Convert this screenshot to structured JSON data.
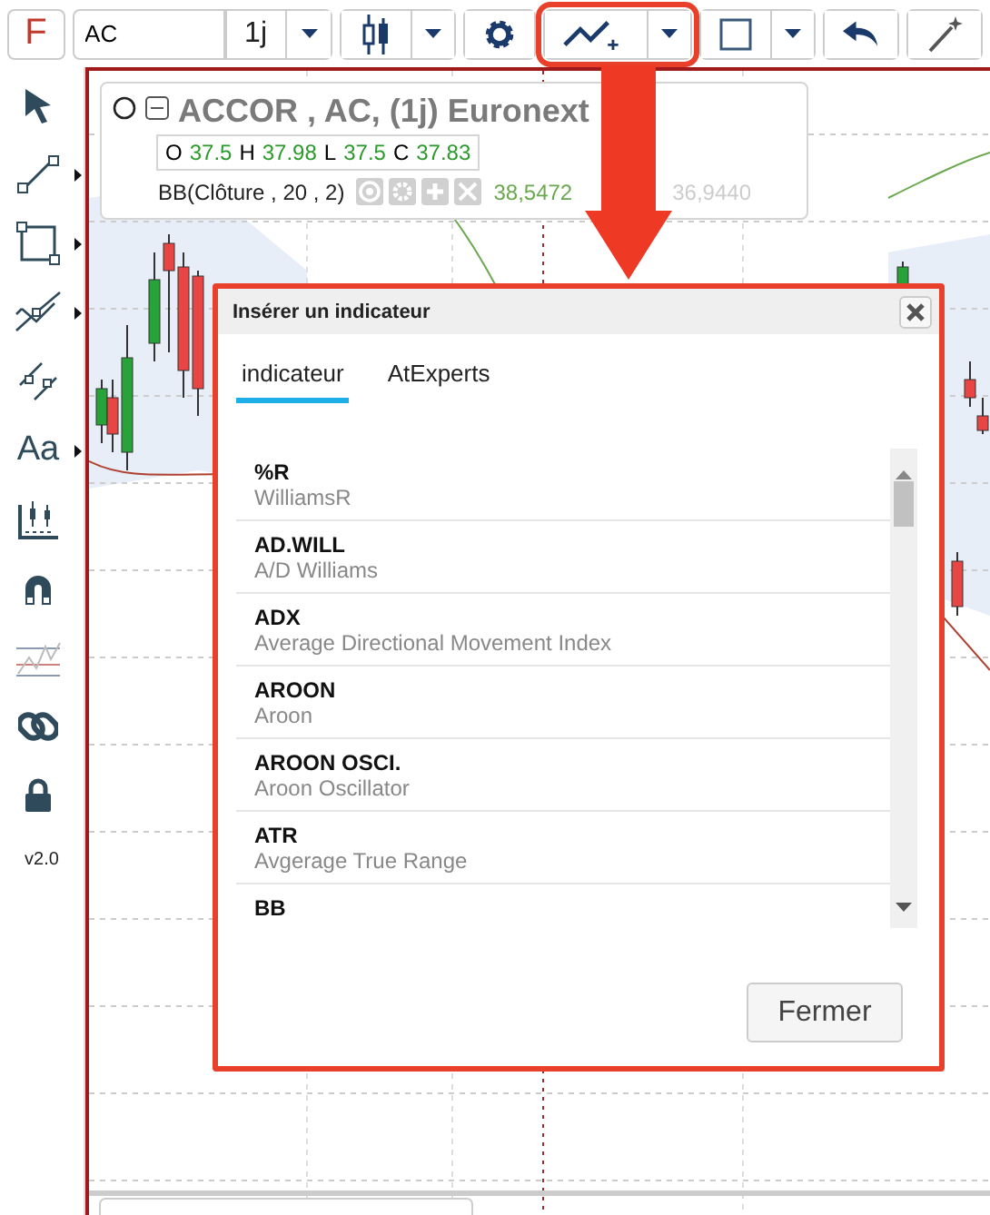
{
  "toolbar": {
    "logo": "F",
    "symbol": "AC",
    "interval": "1j",
    "buttons": [
      {
        "kind": "candles",
        "dropdown": true,
        "highlighted": false
      },
      {
        "kind": "gear",
        "dropdown": false,
        "highlighted": false
      },
      {
        "kind": "indicator",
        "dropdown": true,
        "highlighted": true
      },
      {
        "kind": "rectangle",
        "dropdown": true,
        "highlighted": false
      },
      {
        "kind": "undo",
        "dropdown": false,
        "highlighted": false
      },
      {
        "kind": "wand",
        "dropdown": false,
        "highlighted": false
      }
    ]
  },
  "sidebar": {
    "tools": [
      {
        "kind": "pointer",
        "submenu": false
      },
      {
        "kind": "line",
        "submenu": true
      },
      {
        "kind": "rectangle",
        "submenu": true
      },
      {
        "kind": "fork",
        "submenu": true
      },
      {
        "kind": "segment",
        "submenu": false
      },
      {
        "kind": "text",
        "label": "Aa",
        "submenu": true
      },
      {
        "kind": "measure",
        "submenu": false
      },
      {
        "kind": "magnet",
        "submenu": false
      },
      {
        "kind": "chart-lines",
        "submenu": false
      },
      {
        "kind": "link",
        "submenu": false
      },
      {
        "kind": "lock",
        "submenu": false
      }
    ],
    "version": "v2.0"
  },
  "legend": {
    "title": "ACCOR , AC, (1j) Euronext",
    "ohlc": [
      {
        "label": "O",
        "value": "37.5"
      },
      {
        "label": "H",
        "value": "37.98"
      },
      {
        "label": "L",
        "value": "37.5"
      },
      {
        "label": "C",
        "value": "37.83"
      }
    ],
    "indicator": "BB(Clôture , 20 , 2)",
    "values": [
      {
        "text": "38,5472",
        "faded": false
      },
      {
        "text": "36,9440",
        "faded": true
      }
    ]
  },
  "dialog": {
    "title": "Insérer un indicateur",
    "tabs": [
      {
        "label": "indicateur",
        "selected": true
      },
      {
        "label": "AtExperts",
        "selected": false
      }
    ],
    "items": [
      {
        "name": "%R",
        "description": "WilliamsR"
      },
      {
        "name": "AD.WILL",
        "description": "A/D Williams"
      },
      {
        "name": "ADX",
        "description": "Average Directional Movement Index"
      },
      {
        "name": "AROON",
        "description": "Aroon"
      },
      {
        "name": "AROON OSCI.",
        "description": "Aroon Oscillator"
      },
      {
        "name": "ATR",
        "description": "Avgerage True Range"
      },
      {
        "name": "BB"
      }
    ],
    "button": "Fermer"
  }
}
